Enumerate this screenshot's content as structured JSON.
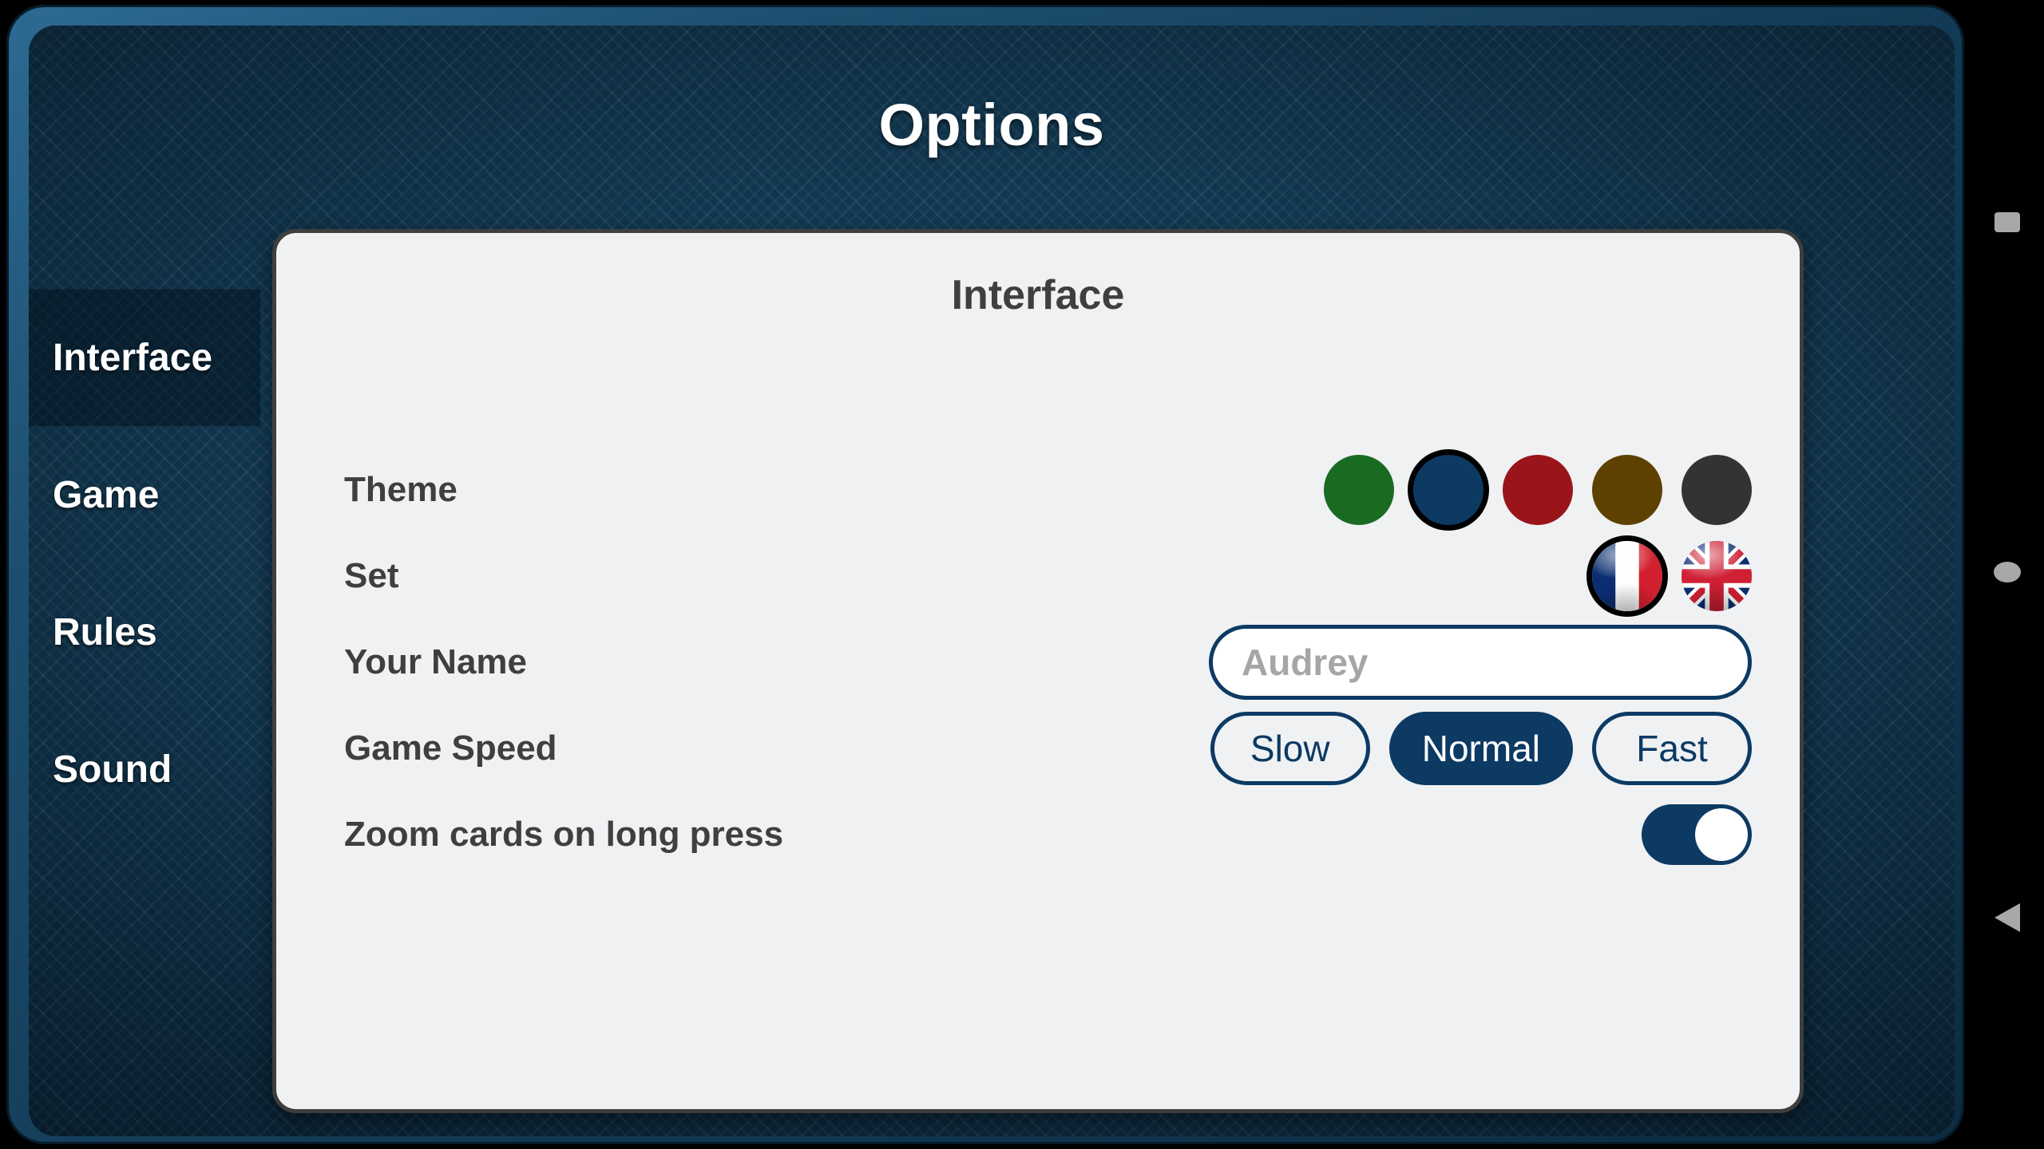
{
  "header": {
    "title": "Options"
  },
  "sidebar": {
    "items": [
      {
        "label": "Interface",
        "name": "sidebar-item-interface",
        "selected": true
      },
      {
        "label": "Game",
        "name": "sidebar-item-game",
        "selected": false
      },
      {
        "label": "Rules",
        "name": "sidebar-item-rules",
        "selected": false
      },
      {
        "label": "Sound",
        "name": "sidebar-item-sound",
        "selected": false
      }
    ]
  },
  "panel": {
    "heading": "Interface",
    "rows": {
      "theme": {
        "label": "Theme",
        "options": [
          {
            "name": "theme-swatch-green",
            "color": "#1a6b22",
            "selected": false
          },
          {
            "name": "theme-swatch-blue",
            "color": "#0d3a62",
            "selected": true
          },
          {
            "name": "theme-swatch-red",
            "color": "#99151a",
            "selected": false
          },
          {
            "name": "theme-swatch-brown",
            "color": "#5e4100",
            "selected": false
          },
          {
            "name": "theme-swatch-dark",
            "color": "#333333",
            "selected": false
          }
        ]
      },
      "set": {
        "label": "Set",
        "options": [
          {
            "name": "flag-france-icon",
            "code": "fr",
            "selected": true
          },
          {
            "name": "flag-united-kingdom-icon",
            "code": "gb",
            "selected": false
          }
        ]
      },
      "your_name": {
        "label": "Your Name",
        "value": "",
        "placeholder": "Audrey"
      },
      "game_speed": {
        "label": "Game Speed",
        "options": [
          {
            "label": "Slow",
            "name": "speed-option-slow",
            "selected": false
          },
          {
            "label": "Normal",
            "name": "speed-option-normal",
            "selected": true
          },
          {
            "label": "Fast",
            "name": "speed-option-fast",
            "selected": false
          }
        ]
      },
      "zoom_cards": {
        "label": "Zoom cards on long press",
        "enabled": true
      }
    }
  },
  "navbar": {
    "items": [
      {
        "name": "nav-recents-button",
        "icon": "square-icon"
      },
      {
        "name": "nav-home-button",
        "icon": "circle-icon"
      },
      {
        "name": "nav-back-button",
        "icon": "triangle-left-icon"
      }
    ]
  },
  "colors": {
    "accent_navy": "#0c3a63",
    "board_blue": "#10374f",
    "panel_bg": "#eff1f3",
    "panel_border": "#3e3e3e",
    "label_text": "#3f3f3f",
    "placeholder_text": "#a6a6a6",
    "navbar_icon": "#a8a8a8"
  }
}
